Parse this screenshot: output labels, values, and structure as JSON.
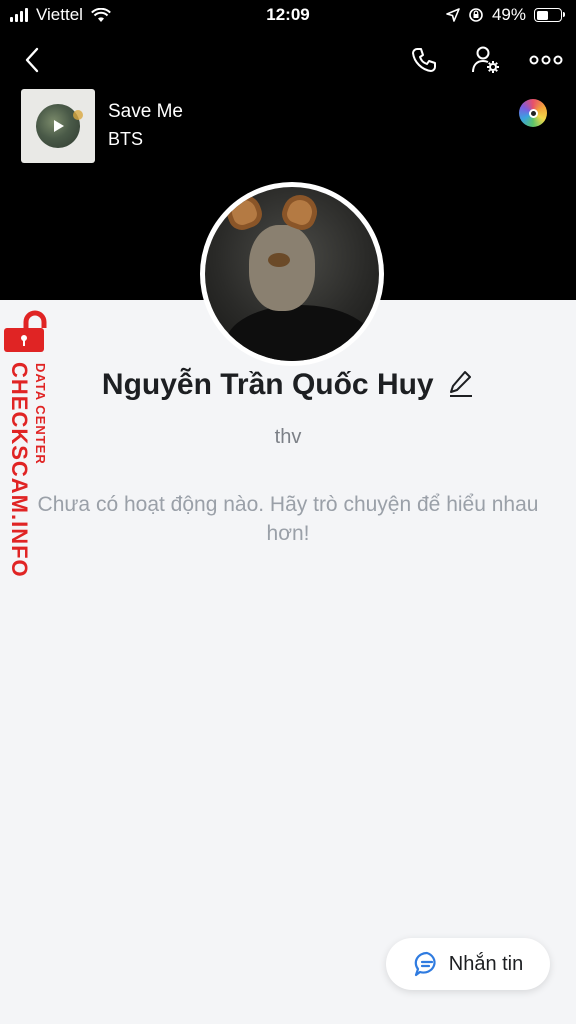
{
  "status_bar": {
    "carrier": "Viettel",
    "time": "12:09",
    "battery_percent": "49%",
    "battery_level": 0.49
  },
  "nav": {
    "icons": [
      "back-icon",
      "phone-icon",
      "user-settings-icon",
      "more-icon"
    ]
  },
  "music": {
    "title": "Save Me",
    "artist": "BTS",
    "icons": [
      "play-icon",
      "music-disc-icon"
    ]
  },
  "profile": {
    "name": "Nguyễn Trần Quốc Huy",
    "subtitle": "thv",
    "empty_message": "Chưa có hoạt động nào. Hãy trò chuyện để hiểu nhau hơn!"
  },
  "watermark": {
    "line1": "DATA CENTER",
    "line2": "CHECKSCAM.INFO"
  },
  "message_button": {
    "label": "Nhắn tin"
  },
  "colors": {
    "header_bg": "#000000",
    "page_bg": "#f4f5f7",
    "accent_blue": "#2f7be0",
    "watermark_red": "#e02424"
  }
}
